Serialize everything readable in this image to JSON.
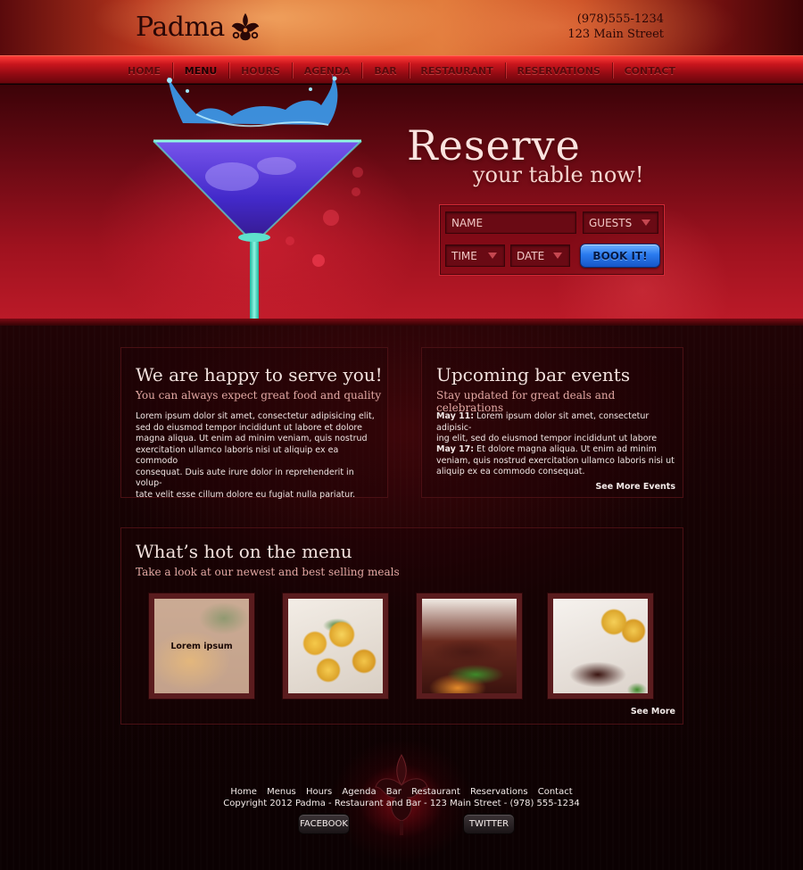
{
  "brand": {
    "name": "Padma"
  },
  "contact": {
    "phone": "(978)555-1234",
    "address": "123 Main Street"
  },
  "nav": {
    "items": [
      {
        "label": "HOME"
      },
      {
        "label": "MENU",
        "active": true
      },
      {
        "label": "HOURS"
      },
      {
        "label": "AGENDA"
      },
      {
        "label": "BAR"
      },
      {
        "label": "RESTAURANT"
      },
      {
        "label": "RESERVATIONS"
      },
      {
        "label": "CONTACT"
      }
    ]
  },
  "hero": {
    "title": "Reserve",
    "subtitle": "your table now!",
    "form": {
      "name_placeholder": "NAME",
      "guests_label": "GUESTS",
      "time_label": "TIME",
      "date_label": "DATE",
      "submit_label": "BOOK IT!"
    }
  },
  "welcome": {
    "title": "We are happy to serve you!",
    "subtitle": "You can always expect great food and quality",
    "lines": [
      "Lorem ipsum dolor sit amet, consectetur adipisicing elit,",
      "sed do eiusmod tempor incididunt ut labore et dolore",
      "magna aliqua. Ut enim ad minim veniam, quis nostrud",
      "exercitation ullamco laboris nisi ut aliquip ex ea commodo",
      "consequat. Duis aute irure dolor in reprehenderit in volup-",
      "tate velit esse cillum dolore eu fugiat nulla pariatur."
    ]
  },
  "events": {
    "title": "Upcoming bar events",
    "subtitle": "Stay updated for great deals and celebrations",
    "items": [
      {
        "date": "May 11:",
        "line1": "Lorem ipsum dolor sit amet, consectetur adipisic-",
        "line2": "ing elit, sed do eiusmod tempor incididunt ut labore"
      },
      {
        "date": "May 17:",
        "line1": "Et dolore magna aliqua. Ut enim ad minim",
        "line2": "veniam, quis nostrud exercitation ullamco laboris nisi ut",
        "line3": "aliquip ex ea commodo consequat."
      }
    ],
    "more_label": "See More Events"
  },
  "menu": {
    "title": "What’s hot on the menu",
    "subtitle": "Take a look at our newest and best selling meals",
    "first_thumb_label": "Lorem ipsum",
    "more_label": "See More"
  },
  "footer": {
    "links": [
      "Home",
      "Menus",
      "Hours",
      "Agenda",
      "Bar",
      "Restaurant",
      "Reservations",
      "Contact"
    ],
    "copyright": "Copyright 2012 Padma - Restaurant and Bar - 123 Main Street - (978) 555-1234",
    "facebook_label": "FACEBOOK",
    "twitter_label": "TWITTER"
  },
  "colors": {
    "accent_red": "#c8161d",
    "book_button_blue": "#2a7bef",
    "panel_border": "#4a1014"
  },
  "icons": [
    "padma-lotus-logo-icon",
    "martini-glass-image",
    "chevron-down-icon"
  ]
}
